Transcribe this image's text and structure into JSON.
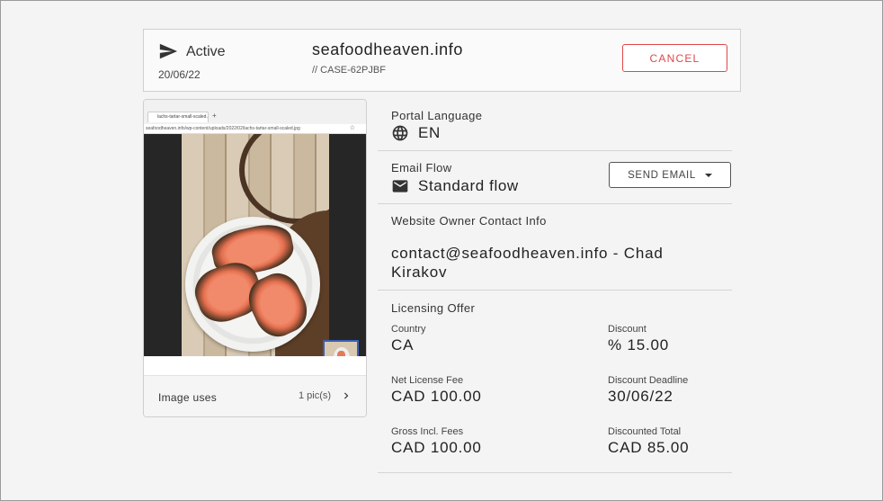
{
  "header": {
    "status_icon": "send-icon",
    "status": "Active",
    "date": "20/06/22",
    "domain": "seafoodheaven.info",
    "case_id": "// CASE-62PJBF",
    "cancel_label": "CANCEL",
    "cancel_color": "#e04848"
  },
  "image_card": {
    "browser_tab_title": "lachs-tartar-small-scaled.jpg",
    "browser_url": "seafoodheaven.info/wp-content/uploads/2022/02/lachs-tartar-small-scaled.jpg",
    "uses_label": "Image uses",
    "uses_count": "1 pic(s)",
    "thumbnail_selected_color": "#3c5fb6"
  },
  "details": {
    "portal_language": {
      "label": "Portal Language",
      "icon": "globe-icon",
      "value": "EN"
    },
    "email_flow": {
      "label": "Email Flow",
      "icon": "mail-icon",
      "value": "Standard flow",
      "send_label": "SEND EMAIL"
    },
    "owner": {
      "label": "Website Owner Contact Info",
      "value": "contact@seafoodheaven.info - Chad Kirakov"
    },
    "offer": {
      "label": "Licensing Offer",
      "country_label": "Country",
      "country": "CA",
      "discount_label": "Discount",
      "discount": "% 15.00",
      "net_fee_label": "Net License Fee",
      "net_fee": "CAD 100.00",
      "deadline_label": "Discount Deadline",
      "deadline": "30/06/22",
      "gross_label": "Gross Incl. Fees",
      "gross": "CAD 100.00",
      "total_label": "Discounted Total",
      "total": "CAD 85.00"
    }
  }
}
